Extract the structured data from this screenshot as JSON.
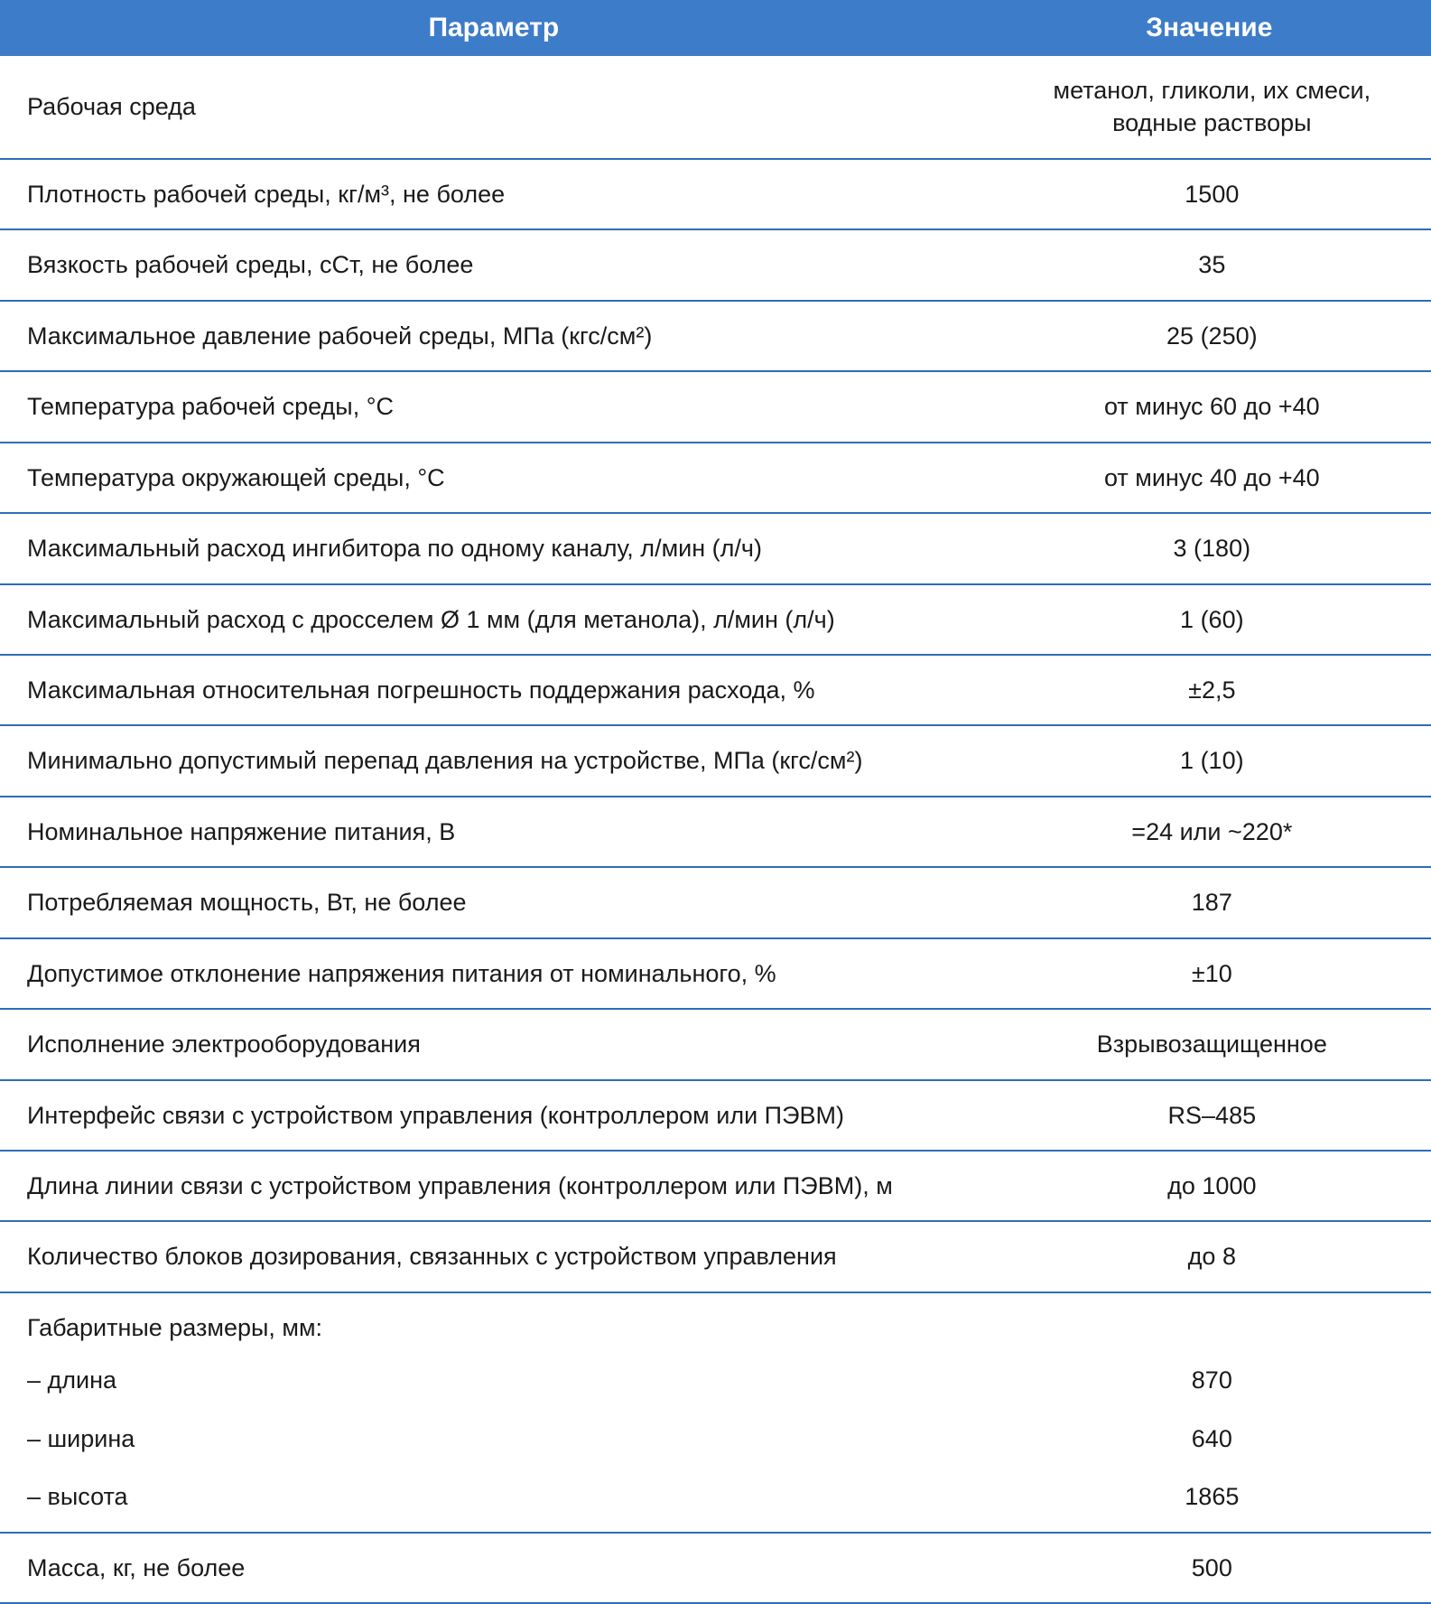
{
  "table": {
    "headers": {
      "param": "Параметр",
      "value": "Значение"
    },
    "rows": [
      {
        "param": "Рабочая среда",
        "value": "метанол, гликоли, их смеси,\nводные растворы"
      },
      {
        "param": "Плотность рабочей среды, кг/м³, не более",
        "value": "1500"
      },
      {
        "param": "Вязкость рабочей среды, сСт, не более",
        "value": "35"
      },
      {
        "param": "Максимальное давление рабочей среды, МПа (кгс/см²)",
        "value": "25 (250)"
      },
      {
        "param": "Температура рабочей среды, °С",
        "value": "от минус 60 до +40"
      },
      {
        "param": "Температура окружающей среды, °С",
        "value": "от минус 40 до +40"
      },
      {
        "param": "Максимальный расход ингибитора по одному каналу, л/мин (л/ч)",
        "value": "3 (180)"
      },
      {
        "param": "Максимальный расход с дросселем Ø 1 мм (для метанола), л/мин (л/ч)",
        "value": "1 (60)"
      },
      {
        "param": "Максимальная относительная погрешность поддержания расхода, %",
        "value": "±2,5"
      },
      {
        "param": "Минимально допустимый перепад давления на устройстве, МПа (кгс/см²)",
        "value": "1 (10)"
      },
      {
        "param": "Номинальное напряжение питания, В",
        "value": "=24 или ~220*"
      },
      {
        "param": "Потребляемая мощность, Вт, не более",
        "value": "187"
      },
      {
        "param": "Допустимое отклонение напряжения питания от номинального, %",
        "value": "±10"
      },
      {
        "param": "Исполнение электрооборудования",
        "value": "Взрывозащищенное"
      },
      {
        "param": "Интерфейс связи с устройством управления (контроллером или ПЭВМ)",
        "value": "RS–485"
      },
      {
        "param": "Длина линии связи с устройством управления (контроллером или ПЭВМ), м",
        "value": "до 1000"
      },
      {
        "param": "Количество блоков дозирования, связанных с устройством управления",
        "value": "до 8"
      }
    ],
    "dimensions": {
      "header": "Габаритные размеры, мм:",
      "items": [
        {
          "label": "– длина",
          "value": "870"
        },
        {
          "label": "– ширина",
          "value": "640"
        },
        {
          "label": "– высота",
          "value": "1865"
        }
      ]
    },
    "mass": {
      "param": "Масса, кг, не более",
      "value": "500"
    }
  }
}
